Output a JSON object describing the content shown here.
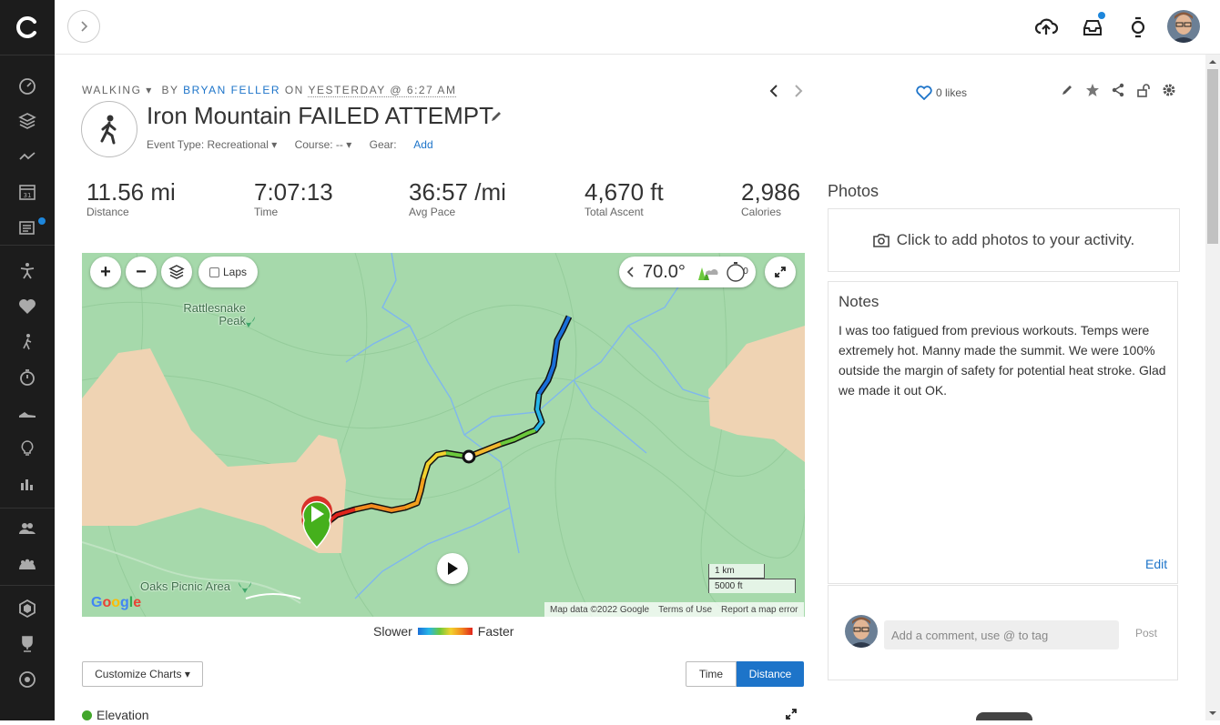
{
  "topbar": {
    "upload_icon": "cloud-upload-icon",
    "inbox_icon": "inbox-icon",
    "device_icon": "watch-icon"
  },
  "activity": {
    "type": "WALKING",
    "by_label": "BY",
    "author": "BRYAN FELLER",
    "on_label": "ON",
    "date": "YESTERDAY @",
    "time": "6:27 AM",
    "title": "Iron Mountain FAILED ATTEMPT",
    "event_type": "Event Type: Recreational ▾",
    "course": "Course: -- ▾",
    "gear_label": "Gear:",
    "gear_action": "Add",
    "likes": "0 likes"
  },
  "stats": [
    {
      "value": "11.56 mi",
      "label": "Distance"
    },
    {
      "value": "7:07:13",
      "label": "Time"
    },
    {
      "value": "36:57 /mi",
      "label": "Avg Pace"
    },
    {
      "value": "4,670 ft",
      "label": "Total Ascent"
    },
    {
      "value": "2,986",
      "label": "Calories"
    }
  ],
  "map": {
    "laps_label": "Laps",
    "temperature": "70.0°",
    "timer_count": "0",
    "place_1": "Rattlesnake Peak",
    "place_2": "Oaks Picnic Area",
    "scale_km": "1 km",
    "scale_ft": "5000 ft",
    "attribution": "Map data ©2022 Google",
    "terms": "Terms of Use",
    "report": "Report a map error",
    "google": "Google",
    "legend_slow": "Slower",
    "legend_fast": "Faster"
  },
  "charts": {
    "customize_label": "Customize Charts ▾",
    "toggle_time": "Time",
    "toggle_distance": "Distance",
    "toggle_active": "Distance",
    "elevation_label": "Elevation"
  },
  "photos": {
    "title": "Photos",
    "add_text": "Click to add photos to your activity."
  },
  "notes": {
    "title": "Notes",
    "text": "I was too fatigued from previous workouts. Temps were extremely hot. Manny made the summit. We were 100% outside the margin of safety for potential heat stroke. Glad we made it out OK.",
    "edit_label": "Edit"
  },
  "comment": {
    "placeholder": "Add a comment, use @ to tag",
    "post_label": "Post"
  },
  "colors": {
    "accent": "#1d74c9",
    "sidebar": "#1c1c1c",
    "map_green": "#a6d9ab",
    "map_tan": "#efd3b3",
    "start_green": "#45b01c"
  }
}
